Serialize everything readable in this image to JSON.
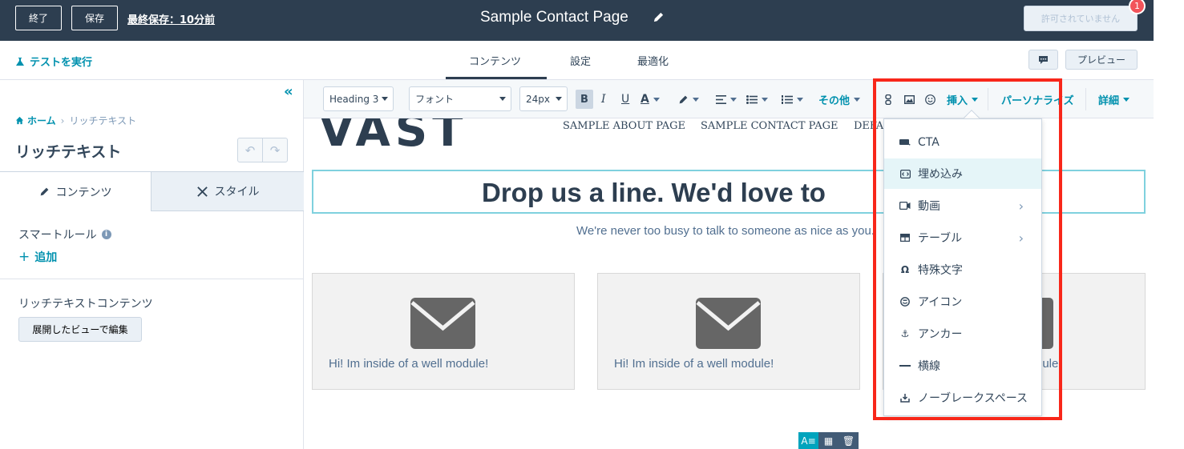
{
  "topbar": {
    "exit_label": "終了",
    "save_label": "保存",
    "last_saved": "最終保存：10分前",
    "page_title": "Sample Contact Page",
    "permission_label": "許可されていません",
    "notification_count": "1"
  },
  "subbar": {
    "run_test": "テストを実行",
    "tabs": [
      {
        "label": "コンテンツ",
        "active": true
      },
      {
        "label": "設定",
        "active": false
      },
      {
        "label": "最適化",
        "active": false
      }
    ],
    "preview": "プレビュー"
  },
  "left_panel": {
    "breadcrumb_home": "ホーム",
    "breadcrumb_current": "リッチテキスト",
    "title": "リッチテキスト",
    "tab_content": "コンテンツ",
    "tab_style": "スタイル",
    "smart_rules": "スマートルール",
    "add": "追加",
    "rich_text_content": "リッチテキストコンテンツ",
    "expand_button": "展開したビューで編集"
  },
  "toolbar": {
    "heading_select": "Heading 3",
    "font_select": "フォント",
    "size_select": "24px",
    "other": "その他",
    "insert": "挿入",
    "personalize": "パーソナライズ",
    "details": "詳細"
  },
  "canvas": {
    "logo": "VAST",
    "nav": [
      "SAMPLE ABOUT PAGE",
      "SAMPLE CONTACT PAGE",
      "DEFAULT"
    ],
    "headline": "Drop us a line. We'd love to",
    "subline": "We're never too busy to talk to someone as nice as you.",
    "well_text": "Hi! Im inside of a well module!",
    "well_text_partial": "dule!"
  },
  "insert_menu": {
    "items": [
      {
        "label": "CTA",
        "icon": "cta-icon",
        "submenu": false,
        "active": false
      },
      {
        "label": "埋め込み",
        "icon": "embed-icon",
        "submenu": false,
        "active": true
      },
      {
        "label": "動画",
        "icon": "video-icon",
        "submenu": true,
        "active": false
      },
      {
        "label": "テーブル",
        "icon": "table-icon",
        "submenu": true,
        "active": false
      },
      {
        "label": "特殊文字",
        "icon": "omega-icon",
        "submenu": false,
        "active": false
      },
      {
        "label": "アイコン",
        "icon": "emoji-icon",
        "submenu": false,
        "active": false
      },
      {
        "label": "アンカー",
        "icon": "anchor-icon",
        "submenu": false,
        "active": false
      },
      {
        "label": "横線",
        "icon": "horizontal-rule-icon",
        "submenu": false,
        "active": false
      },
      {
        "label": "ノーブレークスペース",
        "icon": "nbsp-icon",
        "submenu": false,
        "active": false
      }
    ]
  },
  "colors": {
    "topbar_bg": "#2d3e50",
    "accent": "#0091ae",
    "highlight": "#f8271a"
  }
}
